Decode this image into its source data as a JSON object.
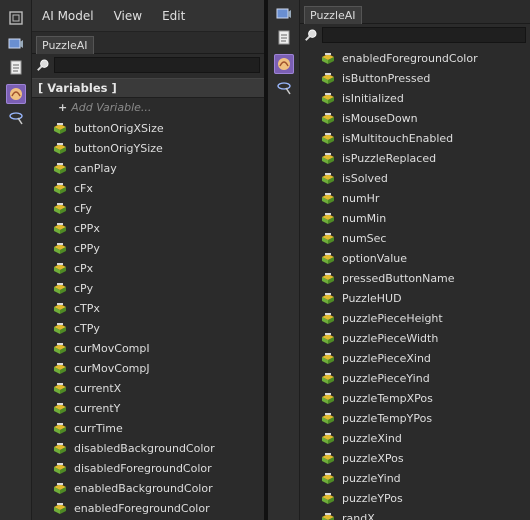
{
  "left": {
    "menu": [
      "AI Model",
      "View",
      "Edit"
    ],
    "tab": "PuzzleAI",
    "section_header": "[ Variables ]",
    "add_variable": "Add Variable...",
    "variables": [
      "buttonOrigXSize",
      "buttonOrigYSize",
      "canPlay",
      "cFx",
      "cFy",
      "cPPx",
      "cPPy",
      "cPx",
      "cPy",
      "cTPx",
      "cTPy",
      "curMovCompI",
      "curMovCompJ",
      "currentX",
      "currentY",
      "currTime",
      "disabledBackgroundColor",
      "disabledForegroundColor",
      "enabledBackgroundColor",
      "enabledForegroundColor"
    ]
  },
  "right": {
    "tab": "PuzzleAI",
    "variables": [
      "enabledForegroundColor",
      "isButtonPressed",
      "isInitialized",
      "isMouseDown",
      "isMultitouchEnabled",
      "isPuzzleReplaced",
      "isSolved",
      "numHr",
      "numMin",
      "numSec",
      "optionValue",
      "pressedButtonName",
      "PuzzleHUD",
      "puzzlePieceHeight",
      "puzzlePieceWidth",
      "puzzlePieceXind",
      "puzzlePieceYind",
      "puzzleTempXPos",
      "puzzleTempYPos",
      "puzzleXind",
      "puzzleXPos",
      "puzzleYind",
      "puzzleYPos",
      "randX"
    ]
  },
  "icons": {
    "toolstrip": [
      "window-icon",
      "scene-icon",
      "document-icon",
      "ai-model-icon",
      "wand-icon"
    ],
    "variable": "variable-cube-icon",
    "search": "search-icon"
  },
  "colors": {
    "panel_bg": "#2b2b2b",
    "active_tool": "#7b5fb3",
    "header_bg": "#3a3a3a",
    "var_icon_green": "#6fae3a",
    "var_icon_yellow": "#e0b930"
  }
}
